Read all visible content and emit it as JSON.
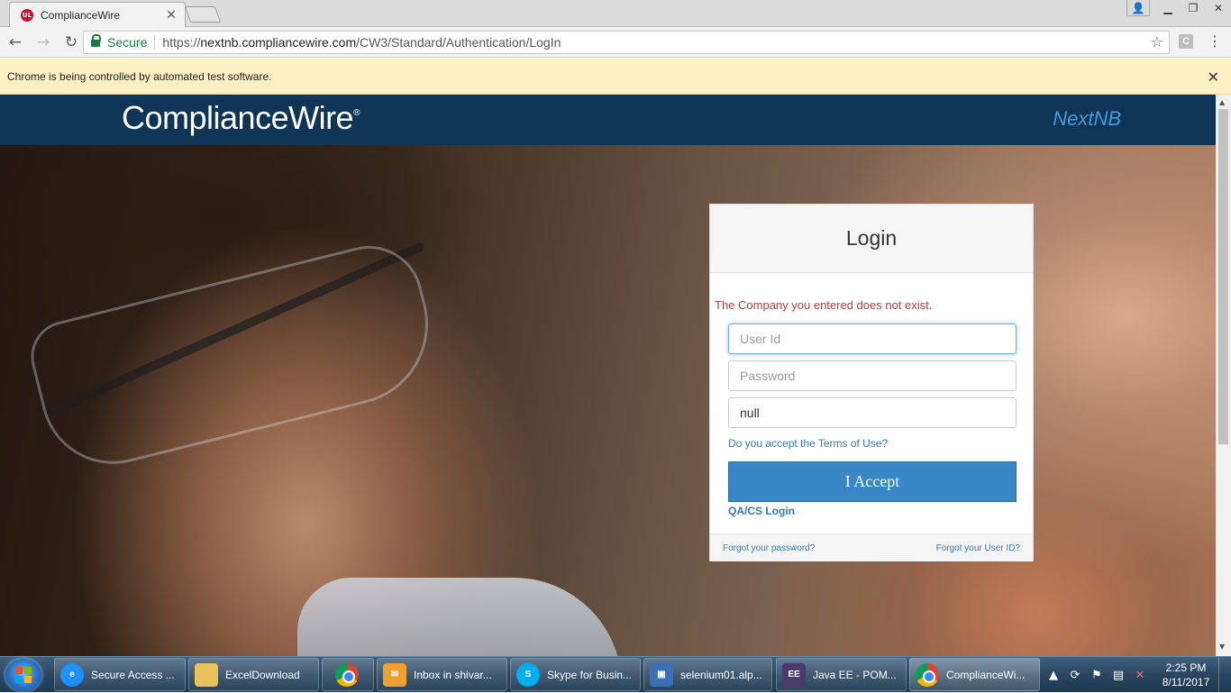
{
  "browser": {
    "tab_title": "ComplianceWire",
    "tab_favicon": "UL",
    "secure_label": "Secure",
    "url_scheme": "https://",
    "url_host": "nextnb.compliancewire.com",
    "url_path": "/CW3/Standard/Authentication/LogIn",
    "extension_label": "C",
    "infobar_text": "Chrome is being controlled by automated test software."
  },
  "header": {
    "brand": "ComplianceWire",
    "brand_mark": "®",
    "environment": "NextNB"
  },
  "login": {
    "title": "Login",
    "error": "The Company you entered does not exist.",
    "userid_placeholder": "User Id",
    "userid_value": "",
    "password_placeholder": "Password",
    "password_value": "",
    "company_value": "null",
    "terms_link": "Do you accept the Terms of Use?",
    "accept_button": "I Accept",
    "qa_link": "QA/CS Login",
    "forgot_password": "Forgot your password?",
    "forgot_userid": "Forgot your User ID?"
  },
  "taskbar": {
    "items": [
      {
        "label": "Secure Access ...",
        "icon": "internet-explorer-icon",
        "color": "#1e90ff"
      },
      {
        "label": "ExcelDownload",
        "icon": "folder-icon",
        "color": "#e8c15a"
      },
      {
        "label": "",
        "icon": "chrome-icon",
        "color": ""
      },
      {
        "label": "Inbox in shivar...",
        "icon": "outlook-icon",
        "color": "#f0a030"
      },
      {
        "label": "Skype for Busin...",
        "icon": "skype-icon",
        "color": "#00aff0"
      },
      {
        "label": "selenium01.alp...",
        "icon": "remote-desktop-icon",
        "color": "#3d6fb5"
      },
      {
        "label": "Java EE - POM...",
        "icon": "eclipse-java-ee-icon",
        "color": "#4b3b6b"
      },
      {
        "label": "ComplianceWi...",
        "icon": "chrome-icon",
        "color": ""
      }
    ],
    "time": "2:25 PM",
    "date": "8/11/2017"
  },
  "colors": {
    "header_bg": "#0f3556",
    "environment_text": "#4a9ad8",
    "accept_button": "#3a87c8",
    "error_text": "#a94442",
    "link": "#337ab7",
    "infobar_bg": "#fcf0c4"
  }
}
